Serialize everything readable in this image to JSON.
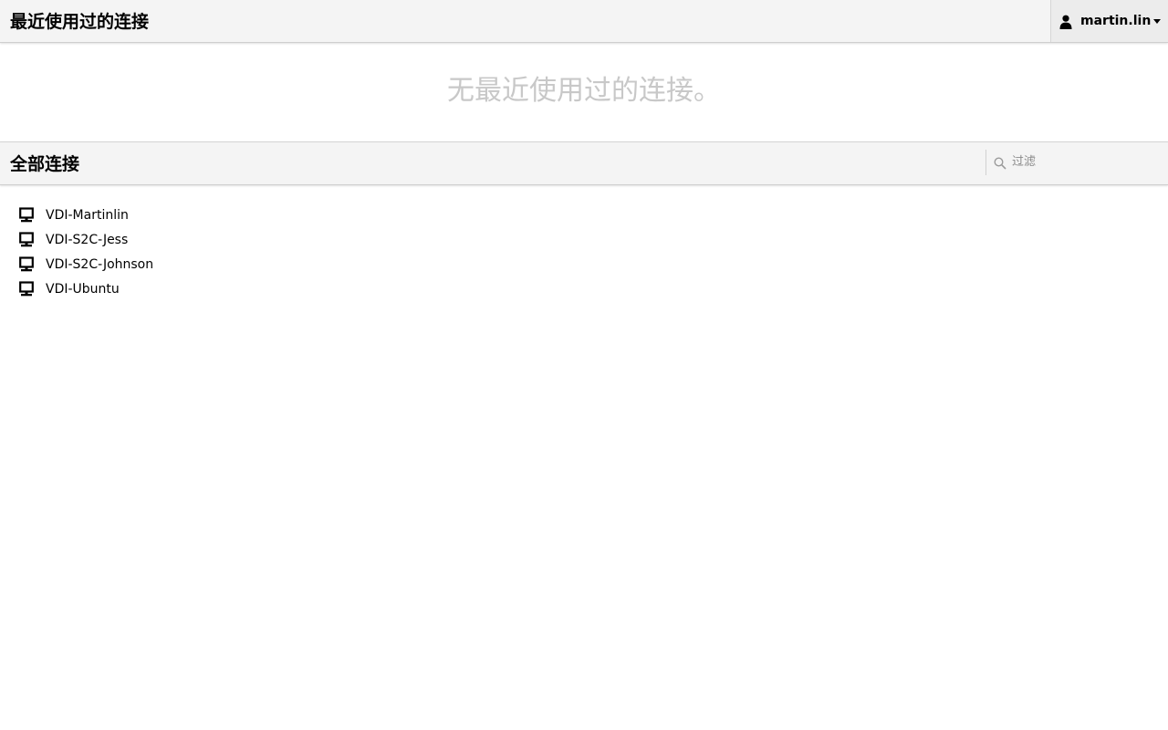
{
  "header": {
    "title": "最近使用过的连接",
    "user": {
      "name": "martin.lin",
      "icon": "user-icon",
      "menu_icon": "caret-down-icon"
    }
  },
  "recent": {
    "empty_message": "无最近使用过的连接。"
  },
  "all_connections": {
    "title": "全部连接",
    "filter": {
      "placeholder": "过滤",
      "value": "",
      "icon": "search-icon"
    },
    "items": [
      {
        "name": "VDI-Martinlin",
        "icon": "monitor-icon"
      },
      {
        "name": "VDI-S2C-Jess",
        "icon": "monitor-icon"
      },
      {
        "name": "VDI-S2C-Johnson",
        "icon": "monitor-icon"
      },
      {
        "name": "VDI-Ubuntu",
        "icon": "monitor-icon"
      }
    ]
  },
  "colors": {
    "bar_background": "#f4f4f4",
    "empty_text": "#c8c8c8",
    "text": "#000000"
  }
}
